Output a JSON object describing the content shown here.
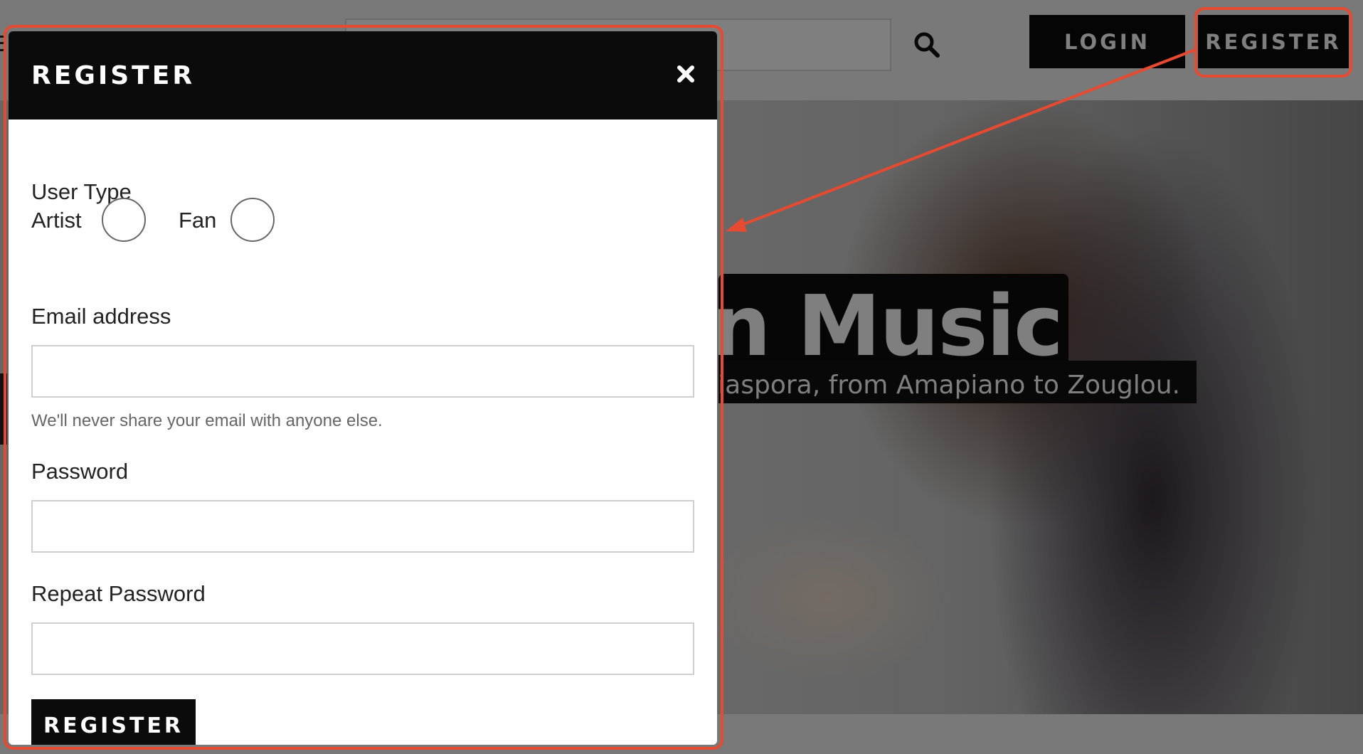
{
  "header": {
    "search": {
      "value": "",
      "placeholder": ""
    },
    "login_label": "LOGIN",
    "register_label": "REGISTER"
  },
  "hero": {
    "title": "ean Music",
    "subtitle": "diaspora, from Amapiano to Zouglou."
  },
  "modal": {
    "title": "REGISTER",
    "close_icon": "close-icon",
    "user_type_label": "User Type",
    "user_types": [
      {
        "label": "Artist",
        "checked": false
      },
      {
        "label": "Fan",
        "checked": false
      }
    ],
    "email_label": "Email address",
    "email_value": "",
    "email_help": "We'll never share your email with anyone else.",
    "password_label": "Password",
    "password_value": "",
    "repeat_password_label": "Repeat Password",
    "repeat_password_value": "",
    "submit_label": "REGISTER"
  },
  "annotation": {
    "color": "#e64a31"
  },
  "colors": {
    "header_bg": "#0b0b0b",
    "overlay": "rgba(0,0,0,0.5)"
  }
}
